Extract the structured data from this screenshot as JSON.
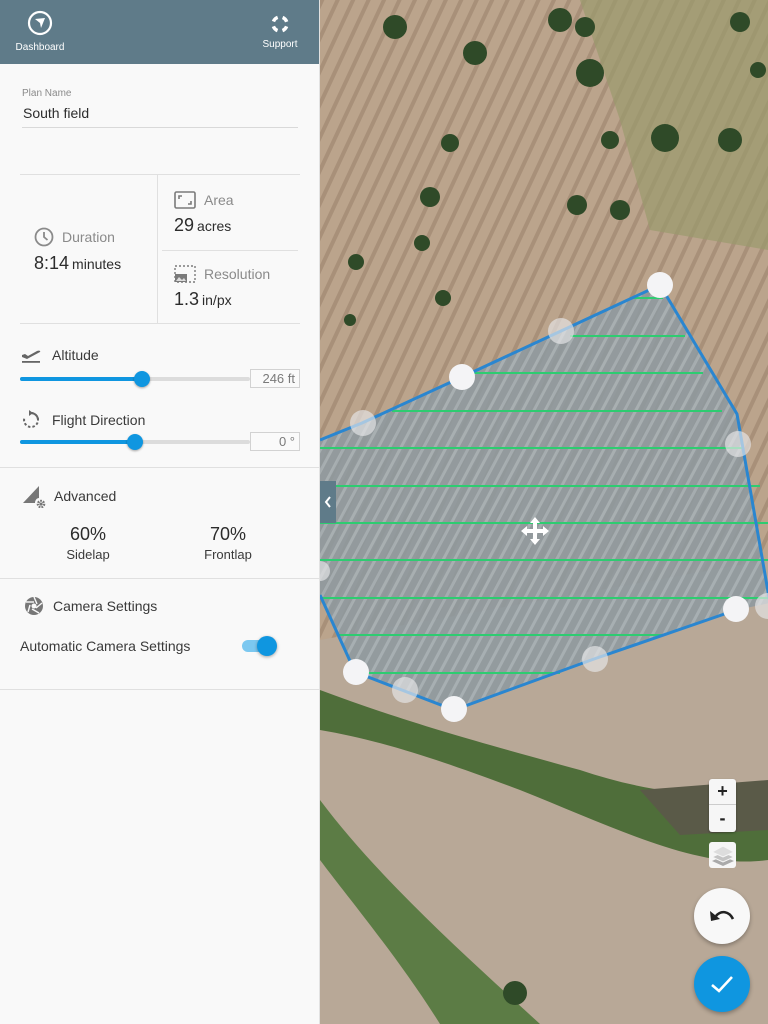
{
  "topbar": {
    "dashboard_label": "Dashboard",
    "support_label": "Support",
    "dashboard_icon": "navigation-arrow-icon",
    "support_icon": "lifebuoy-icon",
    "background": "#5f7b89"
  },
  "plan": {
    "label": "Plan Name",
    "value": "South field"
  },
  "stats": {
    "duration": {
      "label": "Duration",
      "value": "8:14",
      "unit": "minutes"
    },
    "area": {
      "label": "Area",
      "value": "29",
      "unit": "acres"
    },
    "resolution": {
      "label": "Resolution",
      "value": "1.3",
      "unit": "in/px"
    }
  },
  "altitude": {
    "label": "Altitude",
    "value": "246 ft",
    "slider_fraction": 0.53
  },
  "flight_direction": {
    "label": "Flight Direction",
    "value": "0 °",
    "slider_fraction": 0.5
  },
  "advanced": {
    "label": "Advanced",
    "sidelap": {
      "value": "60%",
      "label": "Sidelap"
    },
    "frontlap": {
      "value": "70%",
      "label": "Frontlap"
    }
  },
  "camera": {
    "label": "Camera Settings",
    "auto_label": "Automatic Camera Settings",
    "auto_enabled": true
  },
  "map": {
    "zoom_in": "+",
    "zoom_out": "-",
    "accent": "#0f96e0",
    "boundary_color": "#2a86d0",
    "flight_line_color": "#2ecc71"
  }
}
